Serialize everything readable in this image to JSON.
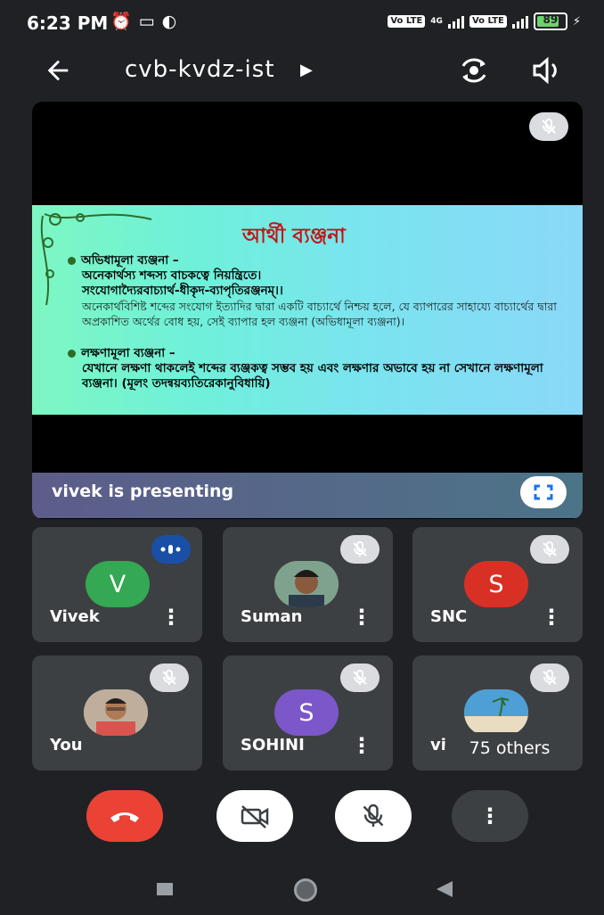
{
  "status_bar": {
    "time": "6:23 PM",
    "left_icons": [
      "alarm-icon",
      "cast-icon",
      "app-icon"
    ],
    "lte_label": "Vo LTE",
    "network_label": "4G",
    "battery_level": "89",
    "battery_color": "#6dd36b"
  },
  "header": {
    "meeting_code": "cvb-kvdz-ist",
    "back_icon": "arrow-left-icon",
    "flip_icon": "switch-camera-icon",
    "audio_icon": "speaker-icon"
  },
  "presentation": {
    "slide": {
      "title": "আর্থী ব্যঞ্জনা",
      "bullet1_head": "অভিধামূলা ব্যঞ্জনা –",
      "bullet1_line1": "অনেকার্থস্য শব্দস্য বাচকত্বে নিয়ন্ত্রিতে।",
      "bullet1_line2": "সংযোগাদ্যৈরবাচ্যার্থ-ধীকৃদ-ব্যাপৃতিরঞ্জনম্‌।।",
      "bullet1_text": "অনেকার্থবিশিষ্ট শব্দের সংযোগ ইত্যাদির দ্বারা একটি বাচ্যার্থে নিশ্চয় হলে, যে ব্যাপারের সাহায্যে বাচ্যার্থের দ্বারা অপ্রকাশিত অর্থের বোধ হয়, সেই ব্যাপার হল ব্যঞ্জনা (অভিধামূলা ব্যঞ্জনা)।",
      "bullet2_head": "লক্ষণামূলা ব্যঞ্জনা –",
      "bullet2_text": "যেখানে লক্ষণা থাকলেই শব্দের ব্যঞ্জকত্ব সম্ভব হয় এবং লক্ষণার অভাবে হয় না সেখানে লক্ষণামূলা ব্যঞ্জনা। (মূলং তদন্বয়ব্যতিরেকানুবিধায়ি)"
    },
    "presenter_text": "vivek is presenting",
    "muted": true
  },
  "participants": [
    {
      "name": "Vivek",
      "initial": "V",
      "avatar_color": "#34a853",
      "status": "speaking",
      "status_color": "#1a4fa8"
    },
    {
      "name": "Suman",
      "initial": "",
      "avatar_color": "#6b8f7a",
      "status": "muted"
    },
    {
      "name": "SNC",
      "initial": "S",
      "avatar_color": "#d93025",
      "status": "muted"
    },
    {
      "name": "You",
      "initial": "",
      "avatar_color": "#c9b9a6",
      "status": "muted"
    },
    {
      "name": "SOHINI",
      "initial": "S",
      "avatar_color": "#7b57c9",
      "status": "muted"
    },
    {
      "name": "viv",
      "initial": "",
      "avatar_color": "#6fb4d8",
      "status": "muted"
    }
  ],
  "others_label": "75 others",
  "controls": [
    {
      "name": "end-call",
      "icon": "phone-hangup-icon",
      "color": "#ea4335"
    },
    {
      "name": "camera-off",
      "icon": "video-off-icon",
      "color": "#ffffff"
    },
    {
      "name": "mic-off",
      "icon": "mic-off-icon",
      "color": "#ffffff"
    },
    {
      "name": "more-options",
      "icon": "more-vert-icon",
      "color": "#3c4043"
    }
  ],
  "nav_bar": [
    "recents-square-icon",
    "home-circle-icon",
    "back-triangle-icon"
  ]
}
